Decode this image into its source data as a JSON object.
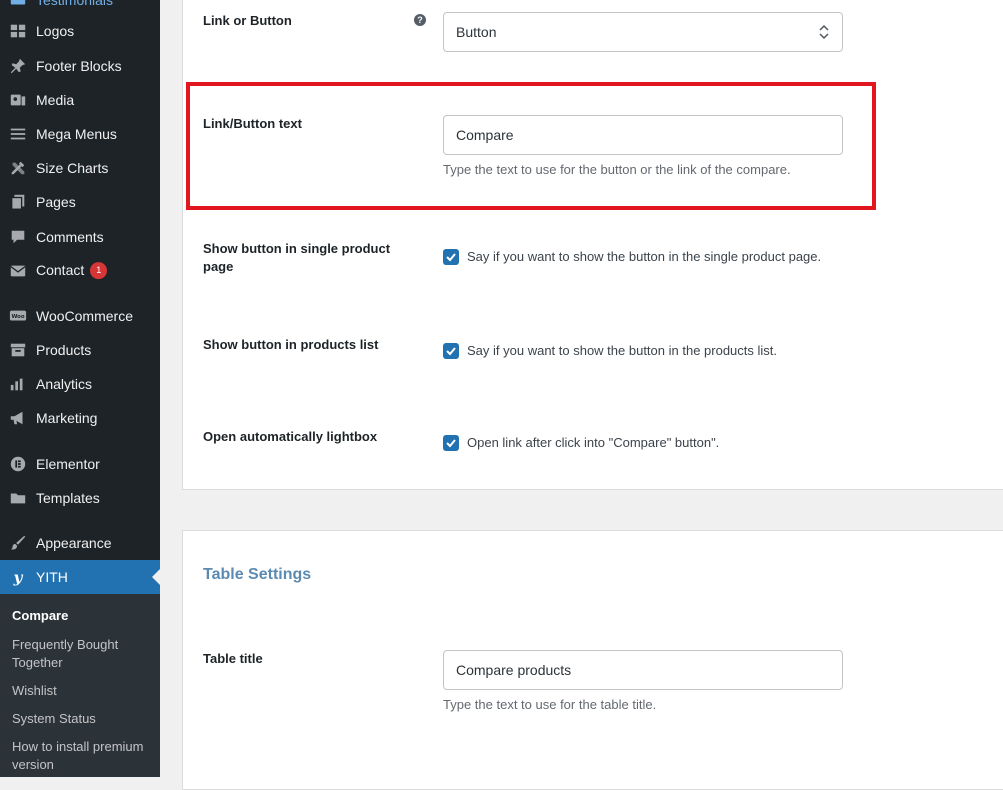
{
  "sidebar": {
    "items": [
      {
        "label": "Testimonials",
        "icon": "testimonials-icon"
      },
      {
        "label": "Logos",
        "icon": "grid-icon"
      },
      {
        "label": "Footer Blocks",
        "icon": "pin-icon"
      },
      {
        "label": "Media",
        "icon": "media-icon"
      },
      {
        "label": "Mega Menus",
        "icon": "menu-icon"
      },
      {
        "label": "Size Charts",
        "icon": "tools-icon"
      },
      {
        "label": "Pages",
        "icon": "pages-icon"
      },
      {
        "label": "Comments",
        "icon": "comment-icon"
      },
      {
        "label": "Contact",
        "icon": "mail-icon",
        "badge": "1"
      },
      {
        "label": "WooCommerce",
        "icon": "woo-icon"
      },
      {
        "label": "Products",
        "icon": "archive-icon"
      },
      {
        "label": "Analytics",
        "icon": "chart-icon"
      },
      {
        "label": "Marketing",
        "icon": "megaphone-icon"
      },
      {
        "label": "Elementor",
        "icon": "elementor-icon"
      },
      {
        "label": "Templates",
        "icon": "folder-icon"
      },
      {
        "label": "Appearance",
        "icon": "brush-icon"
      },
      {
        "label": "YITH",
        "icon": "yith-icon",
        "active": true
      }
    ],
    "submenu": [
      {
        "label": "Compare",
        "current": true
      },
      {
        "label": "Frequently Bought Together"
      },
      {
        "label": "Wishlist"
      },
      {
        "label": "System Status"
      },
      {
        "label": "How to install premium version"
      }
    ]
  },
  "settings": {
    "link_or_button": {
      "label": "Link or Button",
      "value": "Button",
      "help": "?"
    },
    "link_button_text": {
      "label": "Link/Button text",
      "value": "Compare",
      "description": "Type the text to use for the button or the link of the compare."
    },
    "show_single": {
      "label": "Show button in single product page",
      "checked": true,
      "description": "Say if you want to show the button in the single product page."
    },
    "show_list": {
      "label": "Show button in products list",
      "checked": true,
      "description": "Say if you want to show the button in the products list."
    },
    "open_lightbox": {
      "label": "Open automatically lightbox",
      "checked": true,
      "description": "Open link after click into \"Compare\" button\"."
    }
  },
  "table_settings": {
    "title": "Table Settings",
    "table_title": {
      "label": "Table title",
      "value": "Compare products",
      "description": "Type the text to use for the table title."
    }
  },
  "colors": {
    "accent": "#2271b1",
    "highlight": "#e2161e",
    "sidebar_bg": "#1d2327"
  }
}
